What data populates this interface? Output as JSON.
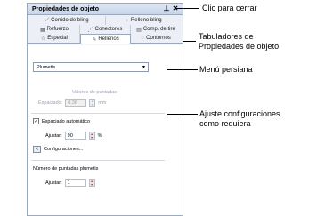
{
  "panel": {
    "title": "Propiedades de objeto",
    "pin_icon": "pin-icon",
    "close_icon": "close-icon"
  },
  "tabs": {
    "row1": [
      {
        "label": "Corrido de bling",
        "icon": "bling-run-icon"
      },
      {
        "label": "Relleno bling",
        "icon": "bling-fill-icon"
      }
    ],
    "row2": [
      {
        "label": "Refuerzo",
        "icon": "reinforce-icon"
      },
      {
        "label": "Conectores",
        "icon": "connector-icon"
      },
      {
        "label": "Comp. de tire",
        "icon": "pull-comp-icon"
      }
    ],
    "row3": [
      {
        "label": "Especial",
        "icon": "star-icon"
      },
      {
        "label": "Rellenos",
        "icon": "fill-icon",
        "active": true
      },
      {
        "label": "Contornos",
        "icon": "outline-icon"
      }
    ]
  },
  "fill": {
    "type_value": "Plumetis",
    "spacing_group_title": "Valores de puntadas",
    "spacing_label": "Espaciado:",
    "spacing_value": "0.38",
    "spacing_unit": "mm",
    "auto_spacing_label": "Espaciado automático",
    "auto_spacing_checked": true,
    "adjust_label": "Ajustar:",
    "adjust_value": "90",
    "adjust_unit": "%",
    "settings_label": "Configuraciones...",
    "settings_button": "<",
    "plumetis_count_label": "Número de puntadas plumetis",
    "adjust2_label": "Ajustar:",
    "adjust2_value": "1"
  },
  "annotations": {
    "close": "Clic para cerrar",
    "tabs_line1": "Tabuladores de",
    "tabs_line2": "Propiedades de objeto",
    "menu": "Menú persiana",
    "adjust_line1": "Ajuste configuraciones",
    "adjust_line2": "como requiera"
  }
}
